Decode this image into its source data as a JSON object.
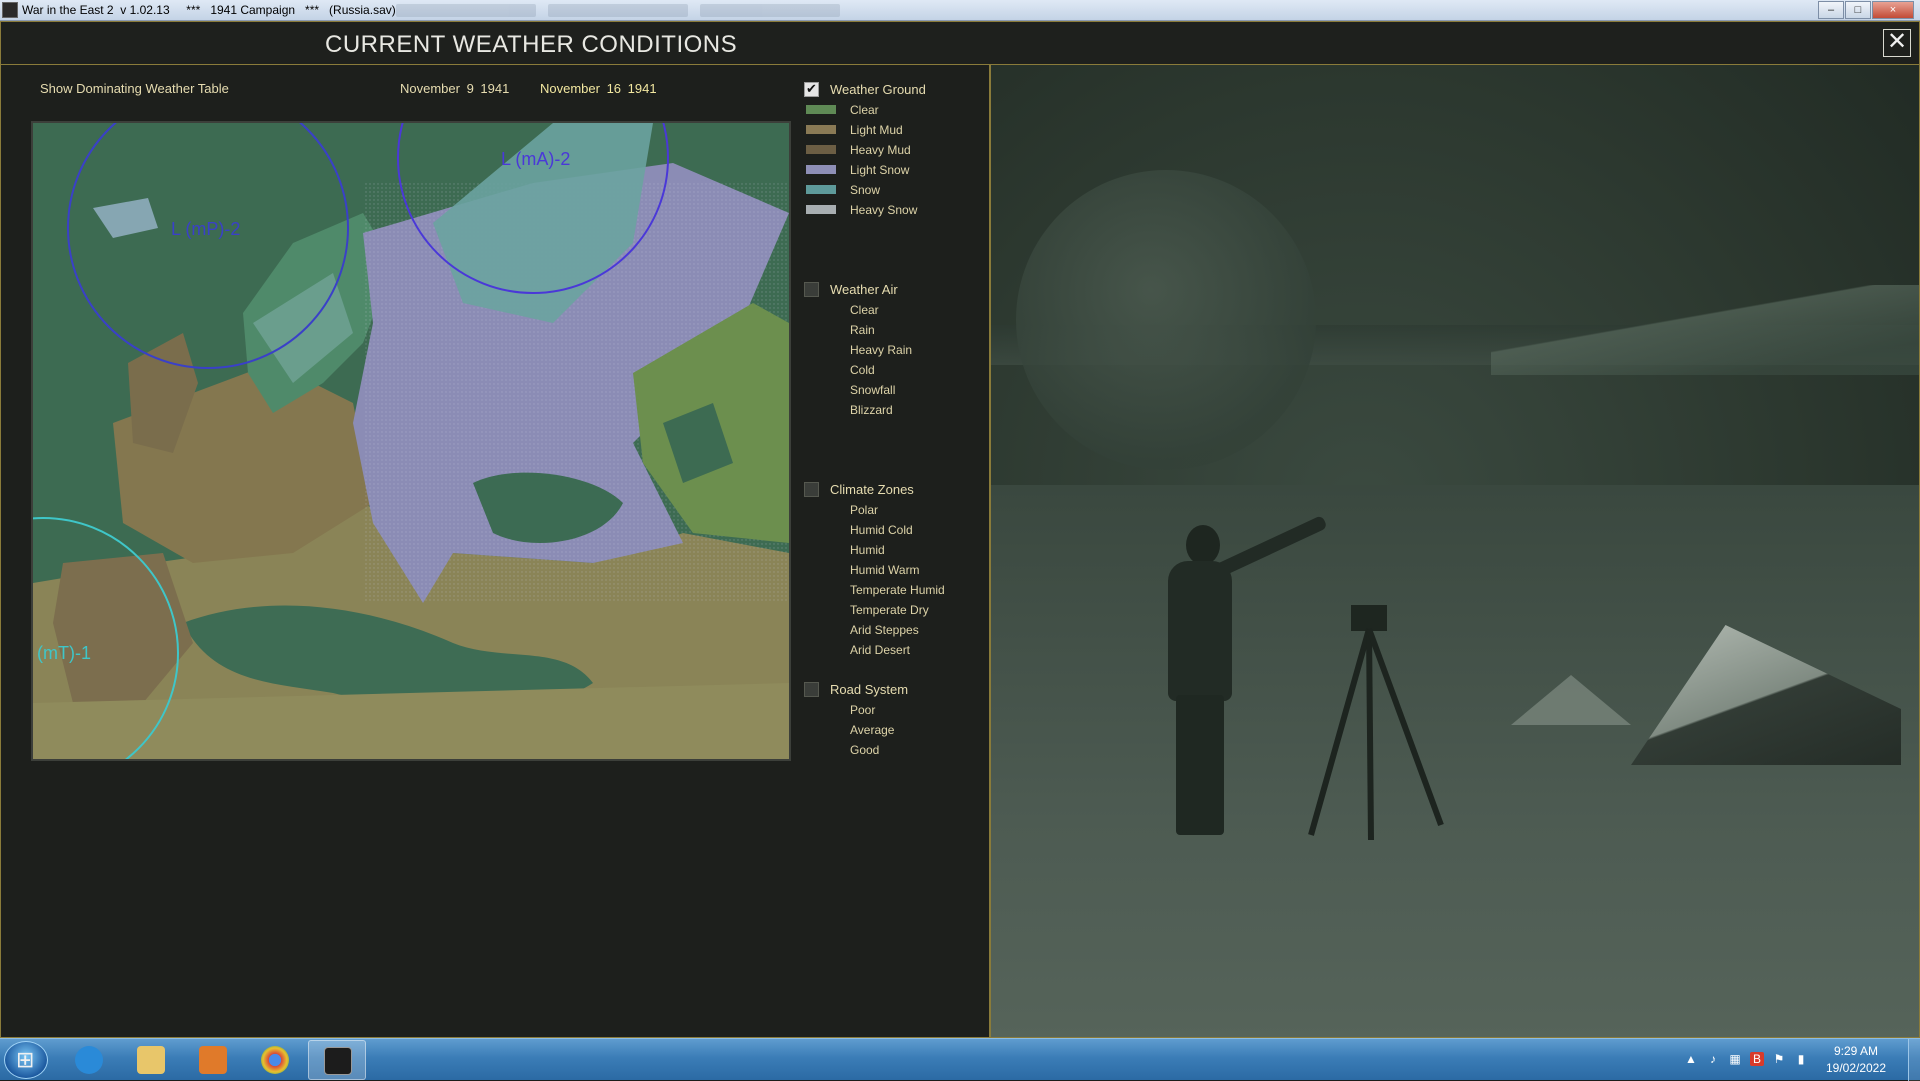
{
  "window": {
    "title": "War in the East 2  v 1.02.13     ***   1941 Campaign   ***   (Russia.sav)",
    "buttons": {
      "minimize": "–",
      "maximize": "□",
      "close": "×"
    }
  },
  "screen": {
    "title": "CURRENT WEATHER CONDITIONS",
    "close_label": "✕",
    "toggle_table": "Show Dominating Weather Table",
    "date_current": "November  9  1941",
    "date_next": "November  16  1941"
  },
  "map": {
    "systems": [
      {
        "label": "L (mP)-2",
        "color": "#3a40c8"
      },
      {
        "label": "L (mA)-2",
        "color": "#4a38d8"
      },
      {
        "label": "(mT)-1",
        "color": "#3fc6c8"
      }
    ]
  },
  "legend": {
    "weather_ground": {
      "label": "Weather Ground",
      "checked": true,
      "items": [
        {
          "label": "Clear",
          "color": "#5f8a55"
        },
        {
          "label": "Light Mud",
          "color": "#8a7a55"
        },
        {
          "label": "Heavy Mud",
          "color": "#6c5e44"
        },
        {
          "label": "Light Snow",
          "color": "#8e8fb6"
        },
        {
          "label": "Snow",
          "color": "#5e9a9a"
        },
        {
          "label": "Heavy Snow",
          "color": "#a8aeb1"
        }
      ]
    },
    "weather_air": {
      "label": "Weather Air",
      "checked": false,
      "items": [
        "Clear",
        "Rain",
        "Heavy Rain",
        "Cold",
        "Snowfall",
        "Blizzard"
      ]
    },
    "climate_zones": {
      "label": "Climate Zones",
      "checked": false,
      "items": [
        "Polar",
        "Humid Cold",
        "Humid",
        "Humid Warm",
        "Temperate Humid",
        "Temperate Dry",
        "Arid Steppes",
        "Arid Desert"
      ]
    },
    "road_system": {
      "label": "Road System",
      "checked": false,
      "items": [
        "Poor",
        "Average",
        "Good"
      ]
    }
  },
  "taskbar": {
    "apps": [
      {
        "name": "internet-explorer-icon",
        "color": "#2a8ad8"
      },
      {
        "name": "file-explorer-icon",
        "color": "#e8c66a"
      },
      {
        "name": "media-player-icon",
        "color": "#e07a2a"
      },
      {
        "name": "chrome-icon",
        "color": "#d94a38"
      },
      {
        "name": "war-in-the-east-icon",
        "color": "#1c1c1c"
      }
    ],
    "clock_time": "9:29 AM",
    "clock_date": "19/02/2022"
  }
}
